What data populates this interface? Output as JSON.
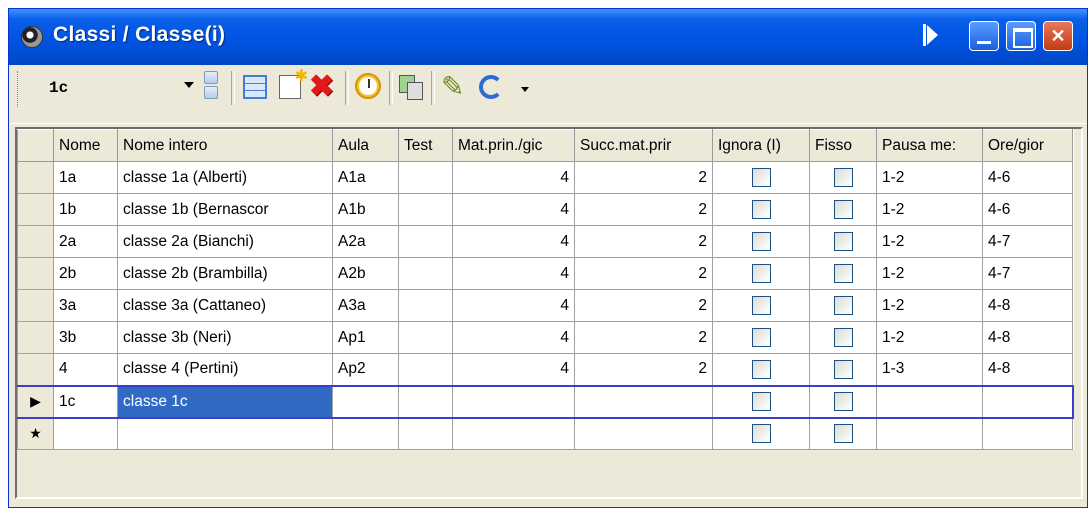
{
  "window": {
    "title": "Classi / Classe(i)"
  },
  "toolbar": {
    "selected_class": "1c",
    "icons": [
      "grid-icon",
      "new-record-icon",
      "delete-icon",
      "clock-icon",
      "copy-icon",
      "brush-icon",
      "refresh-icon",
      "dropdown-more-icon"
    ]
  },
  "grid": {
    "columns": [
      "Nome",
      "Nome intero",
      "Aula",
      "Test",
      "Mat.prin./gic",
      "Succ.mat.prir",
      "Ignora (I)",
      "Fisso",
      "Pausa me:",
      "Ore/gior"
    ],
    "rows": [
      {
        "nome": "1a",
        "nome_intero": "classe 1a (Alberti)",
        "aula": "A1a",
        "test": "",
        "mat": "4",
        "succ": "2",
        "ignora": false,
        "fisso": false,
        "pausa": "1-2",
        "ore": "4-6"
      },
      {
        "nome": "1b",
        "nome_intero": "classe 1b (Bernascor",
        "aula": "A1b",
        "test": "",
        "mat": "4",
        "succ": "2",
        "ignora": false,
        "fisso": false,
        "pausa": "1-2",
        "ore": "4-6"
      },
      {
        "nome": "2a",
        "nome_intero": "classe 2a (Bianchi)",
        "aula": "A2a",
        "test": "",
        "mat": "4",
        "succ": "2",
        "ignora": false,
        "fisso": false,
        "pausa": "1-2",
        "ore": "4-7"
      },
      {
        "nome": "2b",
        "nome_intero": "classe 2b (Brambilla)",
        "aula": "A2b",
        "test": "",
        "mat": "4",
        "succ": "2",
        "ignora": false,
        "fisso": false,
        "pausa": "1-2",
        "ore": "4-7"
      },
      {
        "nome": "3a",
        "nome_intero": "classe 3a (Cattaneo)",
        "aula": "A3a",
        "test": "",
        "mat": "4",
        "succ": "2",
        "ignora": false,
        "fisso": false,
        "pausa": "1-2",
        "ore": "4-8"
      },
      {
        "nome": "3b",
        "nome_intero": "classe 3b (Neri)",
        "aula": "Ap1",
        "test": "",
        "mat": "4",
        "succ": "2",
        "ignora": false,
        "fisso": false,
        "pausa": "1-2",
        "ore": "4-8"
      },
      {
        "nome": "4",
        "nome_intero": "classe 4 (Pertini)",
        "aula": "Ap2",
        "test": "",
        "mat": "4",
        "succ": "2",
        "ignora": false,
        "fisso": false,
        "pausa": "1-3",
        "ore": "4-8"
      },
      {
        "nome": "1c",
        "nome_intero": "classe 1c",
        "aula": "",
        "test": "",
        "mat": "",
        "succ": "",
        "ignora": false,
        "fisso": false,
        "pausa": "",
        "ore": ""
      }
    ],
    "current_row_marker": "▶",
    "new_row_marker": "★"
  }
}
